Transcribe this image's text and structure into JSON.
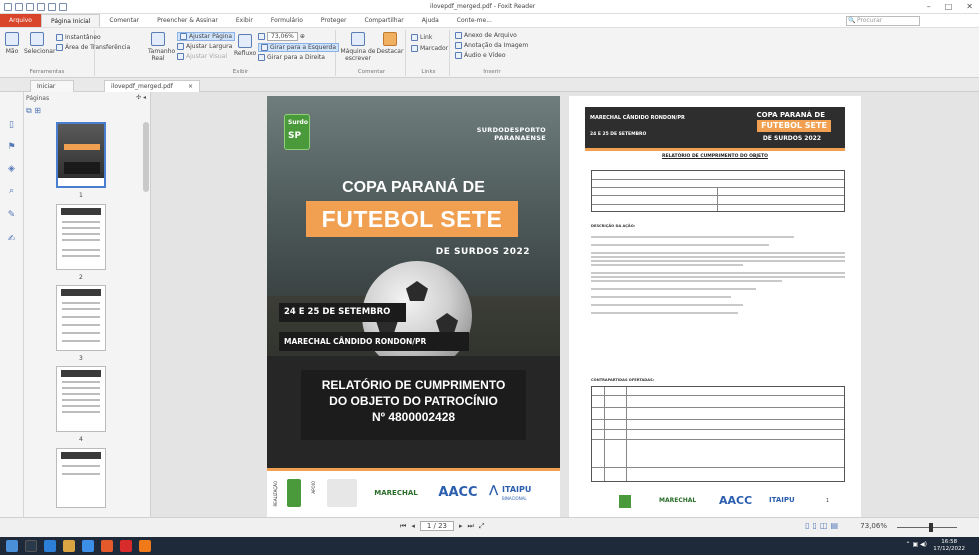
{
  "window": {
    "title": "ilovepdf_merged.pdf - Foxit Reader"
  },
  "menu": [
    "Arquivo",
    "Página Inicial",
    "Comentar",
    "Preencher & Assinar",
    "Exibir",
    "Formulário",
    "Proteger",
    "Compartilhar",
    "Ajuda",
    "Conte-me..."
  ],
  "search": {
    "placeholder": "Procurar"
  },
  "ribbon": {
    "mao": "Mão",
    "selecionar": "Selecionar",
    "instantaneo": "Instantâneo",
    "area_transferencia": "Área de Transferência",
    "ferramentas": "Ferramentas",
    "tamanho_real": "Tamanho Real",
    "ajustar_pagina": "Ajustar Página",
    "ajustar_largura": "Ajustar Largura",
    "ajustar_visual": "Ajustar Visual",
    "refluxo": "Refluxo",
    "zoom": "73,06%",
    "girar_esquerda": "Girar para a Esquerda",
    "girar_direita": "Girar para a Direita",
    "exibir": "Exibir",
    "maquina": "Máquina de escrever",
    "destacar": "Destacar",
    "comentar": "Comentar",
    "link": "Link",
    "marcador": "Marcador",
    "links": "Links",
    "anexo": "Anexo de Arquivo",
    "anotacao": "Anotação da Imagem",
    "audio": "Áudio e Vídeo",
    "inserir": "Inserir"
  },
  "tabs": [
    "Iniciar",
    "ilovepdf_merged.pdf"
  ],
  "thumb_panel": {
    "title": "Páginas",
    "pages": [
      "1",
      "2",
      "3",
      "4"
    ]
  },
  "page1": {
    "org": "SURDODESPORTO",
    "org2": "PARANAENSE",
    "title1": "COPA PARANÁ DE",
    "title2": "FUTEBOL SETE",
    "title3": "DE SURDOS 2022",
    "date": "24 E 25 DE SETEMBRO",
    "location": "MARECHAL CÂNDIDO RONDON/PR",
    "report1": "RELATÓRIO DE CUMPRIMENTO",
    "report2": "DO OBJETO DO PATROCÍNIO",
    "report3": "Nº 4800002428",
    "sponsors": [
      "MARECHAL",
      "AACC",
      "ITAIPU"
    ],
    "sponsor_labels": [
      "REALIZAÇÃO",
      "APOIO"
    ],
    "sub_sponsor": "BINACIONAL"
  },
  "page2": {
    "h1": "MARECHAL CÂNDIDO RONDON/PR",
    "h2": "24 E 25 DE SETEMBRO",
    "c1": "COPA PARANÁ DE",
    "c2": "FUTEBOL SETE",
    "c3": "DE SURDOS 2022",
    "title": "RELATÓRIO DE CUMPRIMENTO DO OBJETO",
    "section1": "DESCRIÇÃO DA AÇÃO:",
    "section2": "CONTRAPARTIDAS OFERTADAS:",
    "sponsor_marechal": "MARECHAL",
    "sponsor_aacc": "AACC",
    "sponsor_itaipu": "ITAIPU",
    "page_num": "1",
    "footer_label": "REALIZAÇÃO"
  },
  "pager": {
    "page": "1 / 23"
  },
  "status": {
    "zoom": "73,06%"
  },
  "clock": {
    "time": "16:58",
    "date": "17/12/2022"
  },
  "colors": {
    "accent": "#f0a050",
    "file_menu": "#d9452b",
    "dark": "#2e2e2e"
  }
}
